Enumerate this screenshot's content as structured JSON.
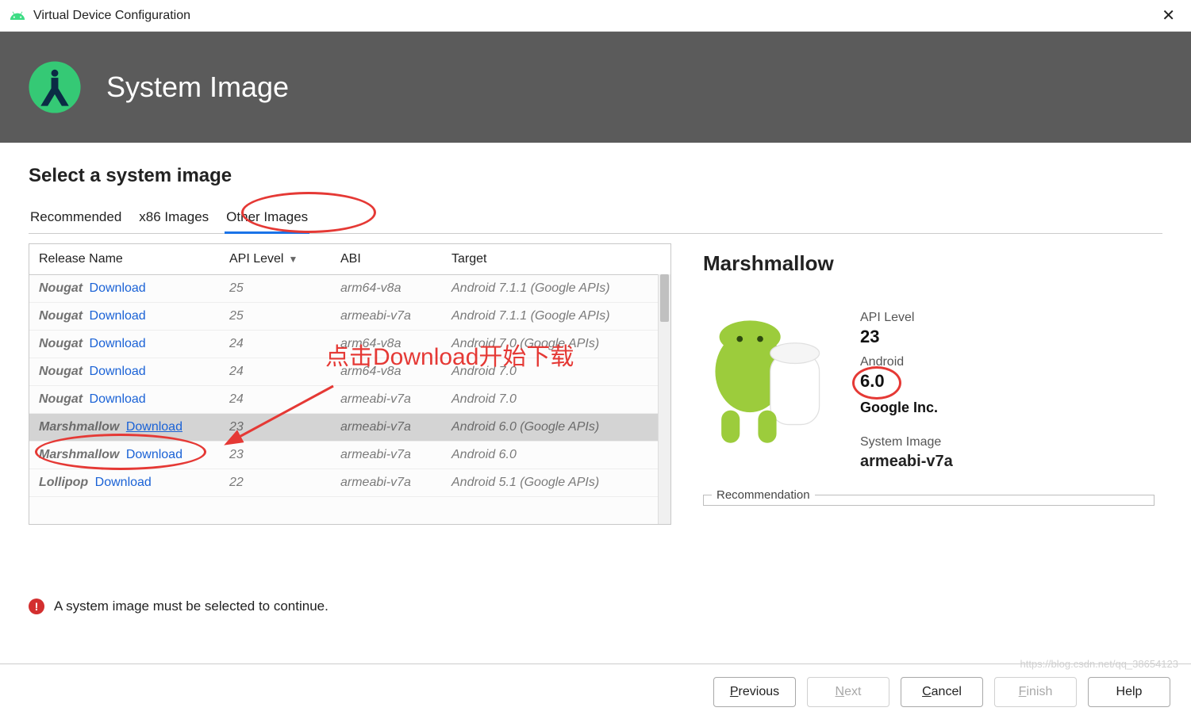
{
  "window": {
    "title": "Virtual Device Configuration"
  },
  "banner": {
    "title": "System Image"
  },
  "section": {
    "title": "Select a system image"
  },
  "tabs": [
    {
      "label": "Recommended"
    },
    {
      "label": "x86 Images"
    },
    {
      "label": "Other Images"
    }
  ],
  "table": {
    "headers": {
      "release": "Release Name",
      "api": "API Level",
      "abi": "ABI",
      "target": "Target"
    },
    "download_label": "Download",
    "rows": [
      {
        "name": "Nougat",
        "api": "25",
        "abi": "arm64-v8a",
        "target": "Android 7.1.1 (Google APIs)",
        "download": true,
        "selected": false
      },
      {
        "name": "Nougat",
        "api": "25",
        "abi": "armeabi-v7a",
        "target": "Android 7.1.1 (Google APIs)",
        "download": true,
        "selected": false
      },
      {
        "name": "Nougat",
        "api": "24",
        "abi": "arm64-v8a",
        "target": "Android 7.0 (Google APIs)",
        "download": true,
        "selected": false
      },
      {
        "name": "Nougat",
        "api": "24",
        "abi": "arm64-v8a",
        "target": "Android 7.0",
        "download": true,
        "selected": false
      },
      {
        "name": "Nougat",
        "api": "24",
        "abi": "armeabi-v7a",
        "target": "Android 7.0",
        "download": true,
        "selected": false
      },
      {
        "name": "Marshmallow",
        "api": "23",
        "abi": "armeabi-v7a",
        "target": "Android 6.0 (Google APIs)",
        "download": true,
        "selected": true
      },
      {
        "name": "Marshmallow",
        "api": "23",
        "abi": "armeabi-v7a",
        "target": "Android 6.0",
        "download": true,
        "selected": false
      },
      {
        "name": "Lollipop",
        "api": "22",
        "abi": "armeabi-v7a",
        "target": "Android 5.1 (Google APIs)",
        "download": true,
        "selected": false
      }
    ]
  },
  "detail": {
    "title": "Marshmallow",
    "api_label": "API Level",
    "api_value": "23",
    "android_label": "Android",
    "android_value": "6.0",
    "vendor": "Google Inc.",
    "sysimg_label": "System Image",
    "sysimg_value": "armeabi-v7a",
    "recommendation_label": "Recommendation"
  },
  "status": {
    "message": "A system image must be selected to continue."
  },
  "footer": {
    "previous": "Previous",
    "previous_mn": "P",
    "next": "Next",
    "next_mn": "N",
    "cancel": "Cancel",
    "cancel_mn": "C",
    "finish": "Finish",
    "finish_mn": "F",
    "help": "Help"
  },
  "annotation": {
    "text": "点击Download开始下载"
  },
  "watermark": "https://blog.csdn.net/qq_38654123"
}
